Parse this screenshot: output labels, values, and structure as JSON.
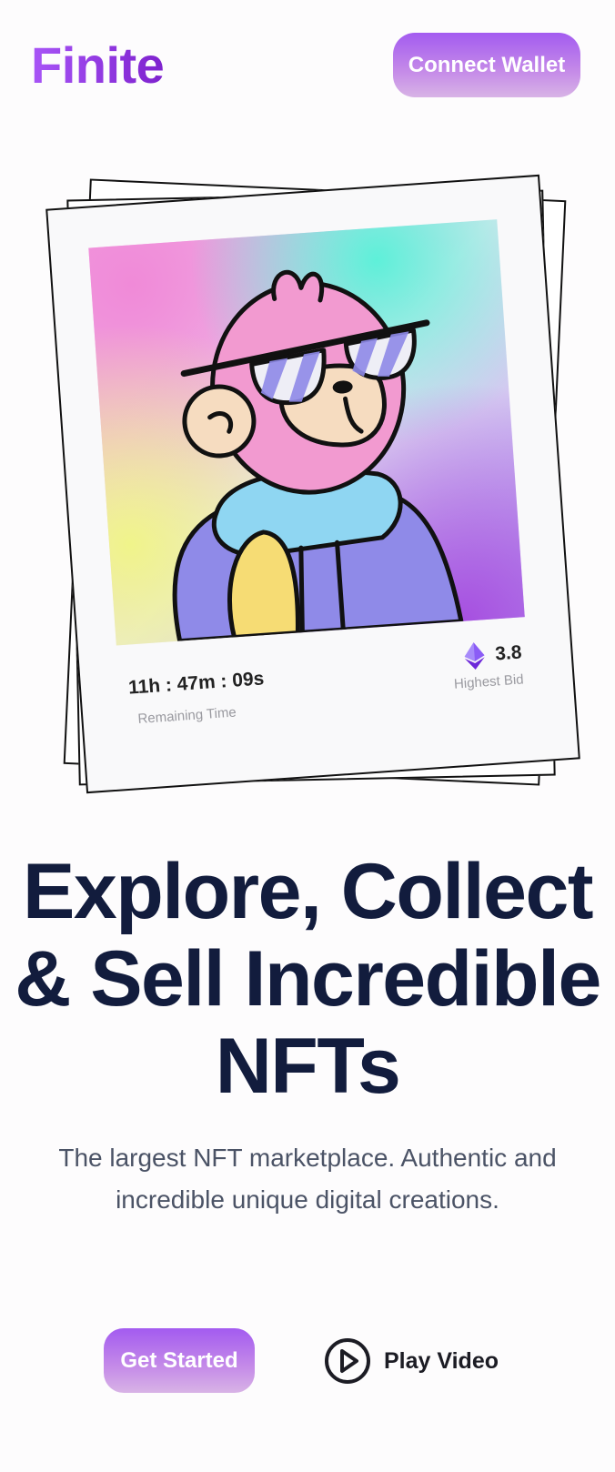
{
  "header": {
    "logo": "Finite",
    "connect_wallet_label": "Connect Wallet"
  },
  "nft_card": {
    "remaining_time": "11h : 47m : 09s",
    "remaining_time_label": "Remaining Time",
    "highest_bid_value": "3.8",
    "highest_bid_label": "Highest Bid",
    "currency_icon": "ethereum-icon"
  },
  "hero": {
    "title": "Explore, Collect & Sell Incredible NFTs",
    "subtitle": "The largest NFT marketplace. Authentic and incredible unique digital creations."
  },
  "actions": {
    "get_started_label": "Get Started",
    "play_video_label": "Play Video",
    "play_icon": "play-circle-icon"
  },
  "colors": {
    "brand": "#9333ea",
    "heading": "#121c3d",
    "body_text": "#4b5366"
  }
}
